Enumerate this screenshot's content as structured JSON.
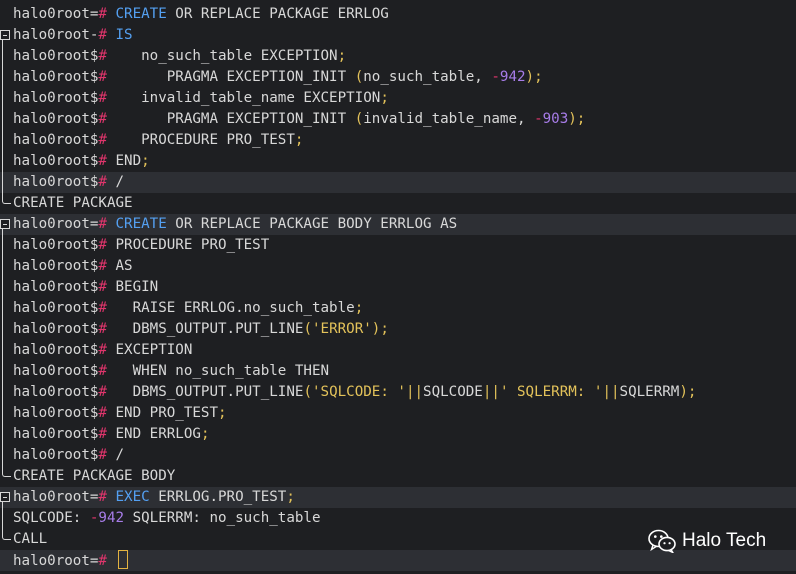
{
  "terminal": {
    "lines": [
      {
        "hl": false,
        "tokens": [
          [
            "p",
            "halo0root="
          ],
          [
            "s",
            "#"
          ],
          [
            "t",
            " "
          ],
          [
            "k",
            "CREATE"
          ],
          [
            "t",
            " OR REPLACE PACKAGE ERRLOG"
          ]
        ]
      },
      {
        "hl": false,
        "tokens": [
          [
            "p",
            "halo0root-"
          ],
          [
            "s",
            "#"
          ],
          [
            "t",
            " "
          ],
          [
            "k",
            "IS"
          ]
        ]
      },
      {
        "hl": false,
        "tokens": [
          [
            "p",
            "halo0root$"
          ],
          [
            "s",
            "#"
          ],
          [
            "t",
            "    no_such_table EXCEPTION"
          ],
          [
            "y",
            ";"
          ]
        ]
      },
      {
        "hl": false,
        "tokens": [
          [
            "p",
            "halo0root$"
          ],
          [
            "s",
            "#"
          ],
          [
            "t",
            "       PRAGMA EXCEPTION_INIT "
          ],
          [
            "y",
            "("
          ],
          [
            "t",
            "no_such_table, "
          ],
          [
            "s",
            "-"
          ],
          [
            "n",
            "942"
          ],
          [
            "y",
            ")"
          ],
          [
            "y",
            ";"
          ]
        ]
      },
      {
        "hl": false,
        "tokens": [
          [
            "p",
            "halo0root$"
          ],
          [
            "s",
            "#"
          ],
          [
            "t",
            "    invalid_table_name EXCEPTION"
          ],
          [
            "y",
            ";"
          ]
        ]
      },
      {
        "hl": false,
        "tokens": [
          [
            "p",
            "halo0root$"
          ],
          [
            "s",
            "#"
          ],
          [
            "t",
            "       PRAGMA EXCEPTION_INIT "
          ],
          [
            "y",
            "("
          ],
          [
            "t",
            "invalid_table_name, "
          ],
          [
            "s",
            "-"
          ],
          [
            "n",
            "903"
          ],
          [
            "y",
            ")"
          ],
          [
            "y",
            ";"
          ]
        ]
      },
      {
        "hl": false,
        "tokens": [
          [
            "p",
            "halo0root$"
          ],
          [
            "s",
            "#"
          ],
          [
            "t",
            "    PROCEDURE PRO_TEST"
          ],
          [
            "y",
            ";"
          ]
        ]
      },
      {
        "hl": false,
        "tokens": [
          [
            "p",
            "halo0root$"
          ],
          [
            "s",
            "#"
          ],
          [
            "t",
            " END"
          ],
          [
            "y",
            ";"
          ]
        ]
      },
      {
        "hl": true,
        "tokens": [
          [
            "p",
            "halo0root$"
          ],
          [
            "s",
            "#"
          ],
          [
            "t",
            " /"
          ]
        ]
      },
      {
        "hl": false,
        "tokens": [
          [
            "t",
            "CREATE PACKAGE"
          ]
        ]
      },
      {
        "hl": true,
        "tokens": [
          [
            "p",
            "halo0root="
          ],
          [
            "s",
            "#"
          ],
          [
            "t",
            " "
          ],
          [
            "k",
            "CREATE"
          ],
          [
            "t",
            " OR REPLACE PACKAGE BODY ERRLOG AS"
          ]
        ]
      },
      {
        "hl": false,
        "tokens": [
          [
            "p",
            "halo0root$"
          ],
          [
            "s",
            "#"
          ],
          [
            "t",
            " PROCEDURE PRO_TEST"
          ]
        ]
      },
      {
        "hl": false,
        "tokens": [
          [
            "p",
            "halo0root$"
          ],
          [
            "s",
            "#"
          ],
          [
            "t",
            " AS"
          ]
        ]
      },
      {
        "hl": false,
        "tokens": [
          [
            "p",
            "halo0root$"
          ],
          [
            "s",
            "#"
          ],
          [
            "t",
            " BEGIN"
          ]
        ]
      },
      {
        "hl": false,
        "tokens": [
          [
            "p",
            "halo0root$"
          ],
          [
            "s",
            "#"
          ],
          [
            "t",
            "   RAISE ERRLOG.no_such_table"
          ],
          [
            "y",
            ";"
          ]
        ]
      },
      {
        "hl": false,
        "tokens": [
          [
            "p",
            "halo0root$"
          ],
          [
            "s",
            "#"
          ],
          [
            "t",
            "   DBMS_OUTPUT.PUT_LINE"
          ],
          [
            "y",
            "("
          ],
          [
            "y",
            "'ERROR'"
          ],
          [
            "y",
            ")"
          ],
          [
            "y",
            ";"
          ]
        ]
      },
      {
        "hl": false,
        "tokens": [
          [
            "p",
            "halo0root$"
          ],
          [
            "s",
            "#"
          ],
          [
            "t",
            " EXCEPTION"
          ]
        ]
      },
      {
        "hl": false,
        "tokens": [
          [
            "p",
            "halo0root$"
          ],
          [
            "s",
            "#"
          ],
          [
            "t",
            "   WHEN no_such_table THEN"
          ]
        ]
      },
      {
        "hl": false,
        "tokens": [
          [
            "p",
            "halo0root$"
          ],
          [
            "s",
            "#"
          ],
          [
            "t",
            "   DBMS_OUTPUT.PUT_LINE"
          ],
          [
            "y",
            "("
          ],
          [
            "y",
            "'SQLCODE: '"
          ],
          [
            "y",
            "||"
          ],
          [
            "t",
            "SQLCODE"
          ],
          [
            "y",
            "||"
          ],
          [
            "y",
            "' SQLERRM: '"
          ],
          [
            "y",
            "||"
          ],
          [
            "t",
            "SQLERRM"
          ],
          [
            "y",
            ")"
          ],
          [
            "y",
            ";"
          ]
        ]
      },
      {
        "hl": false,
        "tokens": [
          [
            "p",
            "halo0root$"
          ],
          [
            "s",
            "#"
          ],
          [
            "t",
            " END PRO_TEST"
          ],
          [
            "y",
            ";"
          ]
        ]
      },
      {
        "hl": false,
        "tokens": [
          [
            "p",
            "halo0root$"
          ],
          [
            "s",
            "#"
          ],
          [
            "t",
            " END ERRLOG"
          ],
          [
            "y",
            ";"
          ]
        ]
      },
      {
        "hl": false,
        "tokens": [
          [
            "p",
            "halo0root$"
          ],
          [
            "s",
            "#"
          ],
          [
            "t",
            " /"
          ]
        ]
      },
      {
        "hl": false,
        "tokens": [
          [
            "t",
            "CREATE PACKAGE BODY"
          ]
        ]
      },
      {
        "hl": true,
        "tokens": [
          [
            "p",
            "halo0root="
          ],
          [
            "s",
            "#"
          ],
          [
            "t",
            " "
          ],
          [
            "k",
            "EXEC"
          ],
          [
            "t",
            " ERRLOG.PRO_TEST"
          ],
          [
            "y",
            ";"
          ]
        ]
      },
      {
        "hl": false,
        "tokens": [
          [
            "t",
            "SQLCODE: "
          ],
          [
            "s",
            "-"
          ],
          [
            "n",
            "942"
          ],
          [
            "t",
            " SQLERRM: no_such_table"
          ]
        ]
      },
      {
        "hl": false,
        "tokens": [
          [
            "t",
            "CALL"
          ]
        ]
      },
      {
        "hl": true,
        "tokens": [
          [
            "p",
            "halo0root="
          ],
          [
            "s",
            "#"
          ],
          [
            "t",
            " "
          ],
          [
            "c",
            ""
          ]
        ]
      }
    ],
    "watermark": {
      "icon": "wechat-icon",
      "label": "Halo Tech"
    }
  }
}
